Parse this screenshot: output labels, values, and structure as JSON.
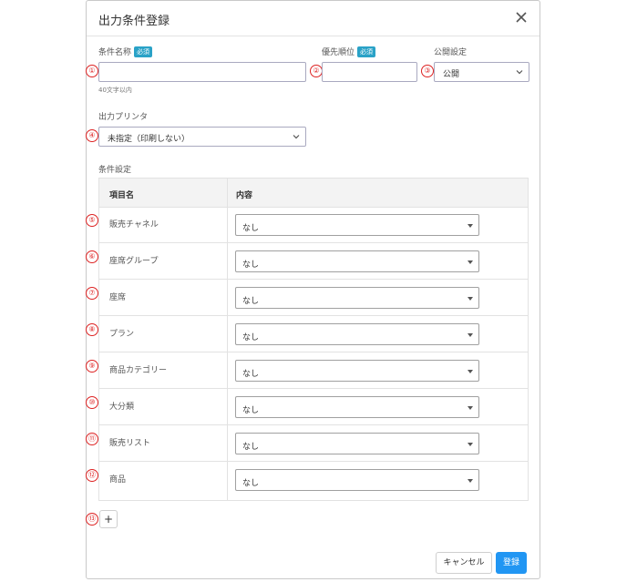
{
  "modal": {
    "title": "出力条件登録"
  },
  "fields": {
    "condition_name": {
      "label": "条件名称",
      "required": "必須",
      "value": "",
      "hint": "40文字以内",
      "marker": "①"
    },
    "priority": {
      "label": "優先順位",
      "required": "必須",
      "value": "",
      "marker": "②"
    },
    "visibility": {
      "label": "公開設定",
      "value": "公開",
      "marker": "③"
    },
    "printer": {
      "label": "出力プリンタ",
      "value": "未指定（印刷しない）",
      "marker": "④"
    }
  },
  "conditions": {
    "label": "条件設定",
    "headers": {
      "item": "項目名",
      "content": "内容"
    },
    "rows": [
      {
        "marker": "⑤",
        "name": "販売チャネル",
        "value": "なし"
      },
      {
        "marker": "⑥",
        "name": "座席グループ",
        "value": "なし"
      },
      {
        "marker": "⑦",
        "name": "座席",
        "value": "なし"
      },
      {
        "marker": "⑧",
        "name": "プラン",
        "value": "なし"
      },
      {
        "marker": "⑨",
        "name": "商品カテゴリー",
        "value": "なし"
      },
      {
        "marker": "⑩",
        "name": "大分類",
        "value": "なし"
      },
      {
        "marker": "⑪",
        "name": "販売リスト",
        "value": "なし"
      },
      {
        "marker": "⑫",
        "name": "商品",
        "value": "なし"
      }
    ],
    "add": {
      "marker": "⑬",
      "label": "+"
    }
  },
  "footer": {
    "cancel_label": "キャンセル",
    "submit_label": "登録"
  },
  "colors": {
    "primary": "#2196f3",
    "required_badge": "#2aa2c7",
    "marker": "#dd2222"
  }
}
